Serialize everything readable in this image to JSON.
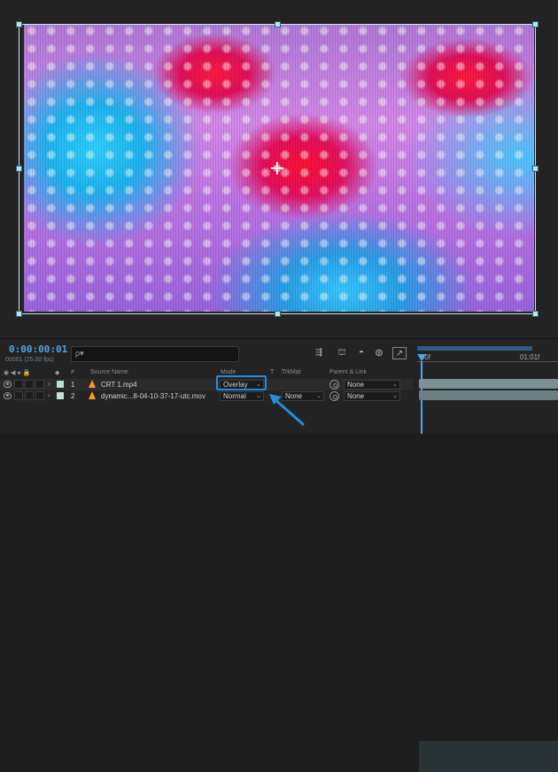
{
  "timeline": {
    "timecode": "0:00:00:01",
    "fps": "00001 (25.00 fps)",
    "search_placeholder": "ρ▾",
    "ruler": {
      "start": "00f",
      "mid": "01:01f"
    }
  },
  "columns": {
    "num": "#",
    "source_name": "Source Name",
    "mode": "Mode",
    "t": "T",
    "trkmat": "TrkMat",
    "parent": "Parent & Link"
  },
  "layers": [
    {
      "num": "1",
      "name": "CRT 1.mp4",
      "mode": "Overlay",
      "trkmat": "",
      "parent": "None",
      "label_color": "#bfe0d8"
    },
    {
      "num": "2",
      "name": "dynamic...8-04-10-37-17-utc.mov",
      "mode": "Normal",
      "trkmat": "None",
      "parent": "None",
      "label_color": "#bfe0d8"
    }
  ],
  "colors": {
    "accent": "#4ba6e8",
    "highlight": "#1f8ee0",
    "file_icon": "#ff9a1f"
  }
}
